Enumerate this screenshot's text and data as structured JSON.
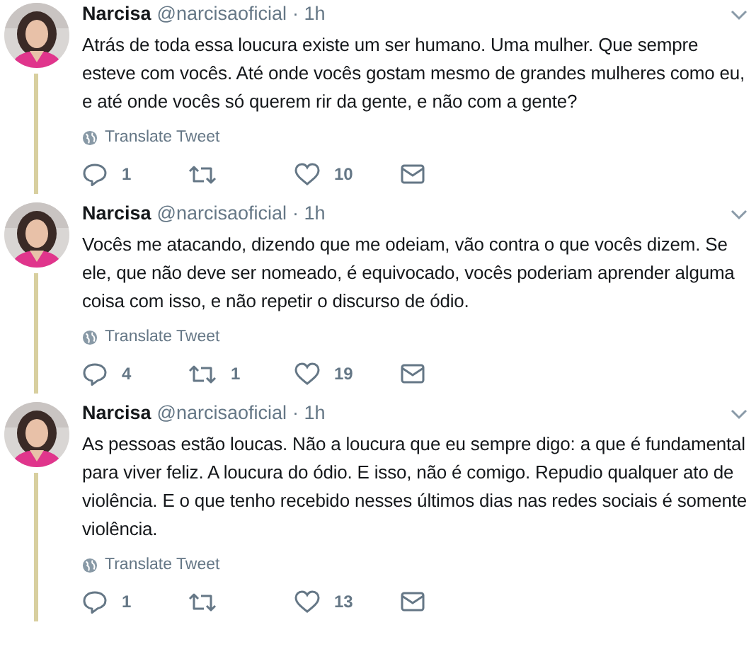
{
  "tweets": [
    {
      "name": "Narcisa",
      "handle": "@narcisaoficial",
      "time": "· 1h",
      "text": "Atrás de toda essa loucura existe um ser humano. Uma mulher. Que sempre esteve com vocês. Até onde vocês gostam mesmo de grandes mulheres como eu, e até onde vocês só querem rir da gente, e não com a gente?",
      "translate": "Translate Tweet",
      "replies": "1",
      "likes": "10",
      "thread_continues": true
    },
    {
      "name": "Narcisa",
      "handle": "@narcisaoficial",
      "time": "· 1h",
      "text": "Vocês me atacando, dizendo que me odeiam, vão contra o que vocês dizem. Se ele, que não deve ser nomeado, é equivocado, vocês poderiam aprender alguma coisa com isso, e não repetir o discurso de ódio.",
      "translate": "Translate Tweet",
      "replies": "4",
      "retweets": "1",
      "likes": "19",
      "thread_continues": true
    },
    {
      "name": "Narcisa",
      "handle": "@narcisaoficial",
      "time": "· 1h",
      "text": "As pessoas estão loucas. Não a loucura que eu sempre digo: a que é fundamental para viver feliz. A loucura do ódio. E isso, não é comigo. Repudio qualquer ato de violência. E o que tenho recebido nesses últimos dias nas redes sociais é somente violência.",
      "translate": "Translate Tweet",
      "replies": "1",
      "likes": "13",
      "thread_continues": true
    }
  ]
}
